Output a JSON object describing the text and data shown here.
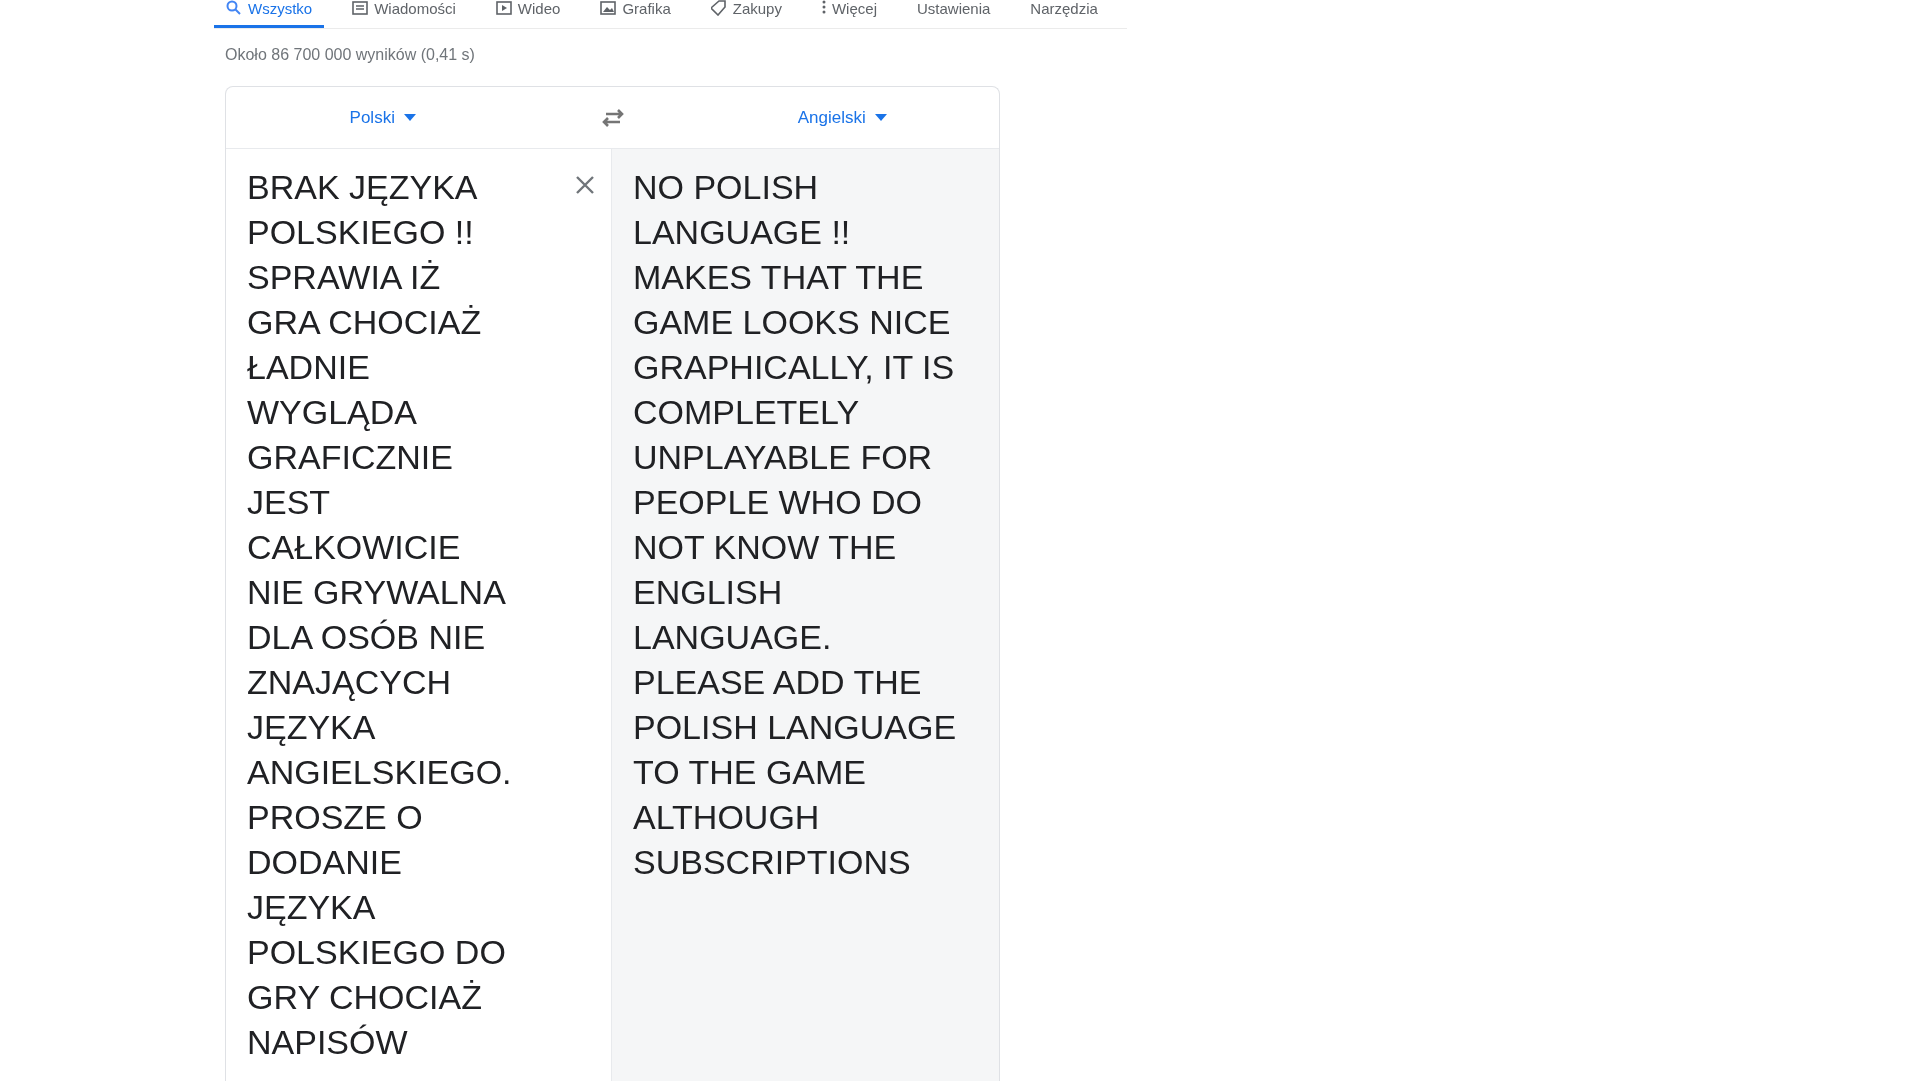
{
  "tabs": [
    {
      "label": "Wszystko",
      "kind": "search",
      "selected": true
    },
    {
      "label": "Wiadomości",
      "kind": "news",
      "selected": false
    },
    {
      "label": "Wideo",
      "kind": "video",
      "selected": false
    },
    {
      "label": "Grafika",
      "kind": "image",
      "selected": false
    },
    {
      "label": "Zakupy",
      "kind": "shopping",
      "selected": false
    },
    {
      "label": "Więcej",
      "kind": "more",
      "selected": false
    },
    {
      "label": "Ustawienia",
      "kind": "plain",
      "selected": false
    },
    {
      "label": "Narzędzia",
      "kind": "plain",
      "selected": false
    }
  ],
  "result_stats": "Około 86 700 000 wyników (0,41 s)",
  "translator": {
    "source_language": "Polski",
    "target_language": "Angielski",
    "source_text": "BRAK JĘZYKA POLSKIEGO !! SPRAWIA IŻ GRA CHOCIAŻ ŁADNIE WYGLĄDA GRAFICZNIE JEST CAŁKOWICIE NIE GRYWALNA DLA OSÓB NIE ZNAJĄCYCH JĘZYKA ANGIELSKIEGO. PROSZE O DODANIE JĘZYKA POLSKIEGO DO GRY CHOCIAŻ NAPISÓW",
    "target_text": "NO POLISH LANGUAGE !! MAKES THAT THE GAME LOOKS NICE GRAPHICALLY, IT IS COMPLETELY UNPLAYABLE FOR PEOPLE WHO DO NOT KNOW THE ENGLISH LANGUAGE. PLEASE ADD THE POLISH LANGUAGE TO THE GAME ALTHOUGH SUBSCRIPTIONS"
  }
}
